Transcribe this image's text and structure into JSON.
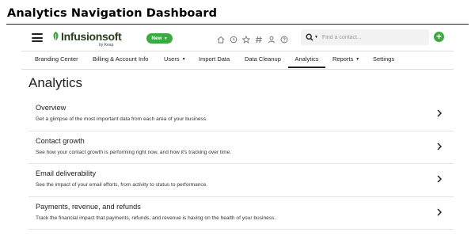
{
  "doc_title": "Analytics Navigation Dashboard",
  "header": {
    "logo_text": "Infusionsoft",
    "logo_sub": "by Keap",
    "new_button": "New",
    "search_placeholder": "Find a contact...",
    "icons": [
      "home-icon",
      "history-icon",
      "star-icon",
      "hashtag-icon",
      "person-icon",
      "help-icon"
    ],
    "accent_color": "#3bab3e"
  },
  "subnav": {
    "items": [
      {
        "label": "Branding Center",
        "dropdown": false,
        "active": false
      },
      {
        "label": "Billing & Account Info",
        "dropdown": false,
        "active": false
      },
      {
        "label": "Users",
        "dropdown": true,
        "active": false
      },
      {
        "label": "Import Data",
        "dropdown": false,
        "active": false
      },
      {
        "label": "Data Cleanup",
        "dropdown": false,
        "active": false
      },
      {
        "label": "Analytics",
        "dropdown": false,
        "active": true
      },
      {
        "label": "Reports",
        "dropdown": true,
        "active": false
      },
      {
        "label": "Settings",
        "dropdown": false,
        "active": false
      }
    ]
  },
  "page": {
    "title": "Analytics",
    "rows": [
      {
        "title": "Overview",
        "description": "Get a glimpse of the most important data from each area of your business."
      },
      {
        "title": "Contact growth",
        "description": "See how your contact growth is performing right now, and how it's tracking over time."
      },
      {
        "title": "Email deliverability",
        "description": "See the impact of your email efforts, from activity to status to performance."
      },
      {
        "title": "Payments, revenue, and refunds",
        "description": "Track the financial impact that payments, refunds, and revenue is having on the health of your business."
      }
    ]
  }
}
